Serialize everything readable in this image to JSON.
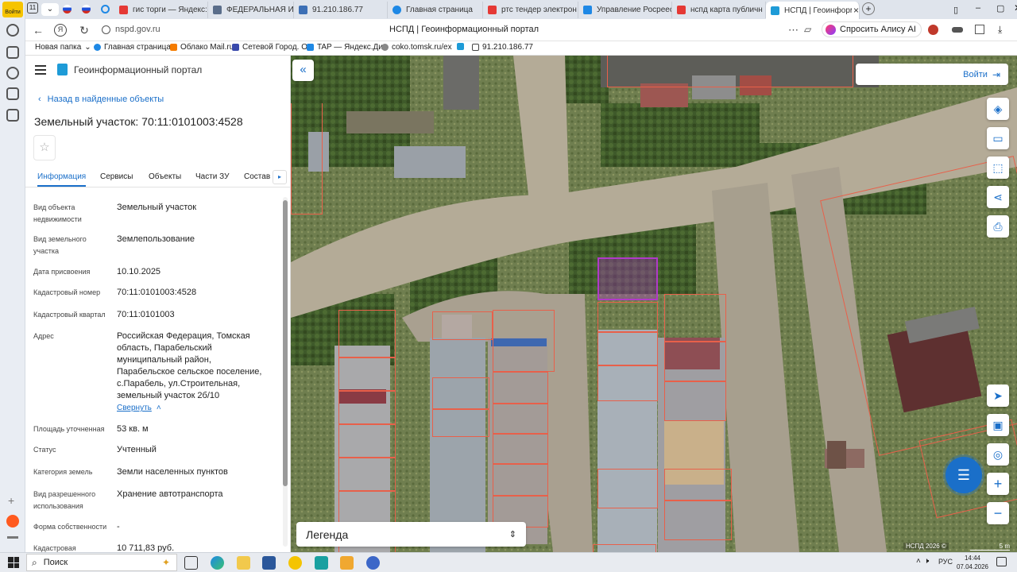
{
  "browser": {
    "sidebar_login": "Войти",
    "tab_count": "11",
    "tabs": [
      {
        "title": "гис торги — Яндекс:н",
        "color": "#e53935"
      },
      {
        "title": "ФЕДЕРАЛЬНАЯ ИНФ",
        "color": "#5a6d8a"
      },
      {
        "title": "91.210.186.77",
        "color": "#3c6fb5"
      },
      {
        "title": "Главная страница",
        "color": "#1e88e5"
      },
      {
        "title": "ртс тендер электрон",
        "color": "#e53935"
      },
      {
        "title": "Управление Росреес",
        "color": "#1e88e5"
      },
      {
        "title": "нспд карта публичн",
        "color": "#e53935"
      },
      {
        "title": "НСПД | Геоинформ",
        "color": "#1e9bd7"
      }
    ],
    "tab_close": "×",
    "new_tab": "+",
    "url": "nspd.gov.ru",
    "page_title": "НСПД | Геоинформационный портал",
    "alice_label": "Спросить Алису AI",
    "bookmarks": [
      {
        "label": "Новая папка",
        "color": ""
      },
      {
        "label": "Главная страница",
        "color": "#1e88e5"
      },
      {
        "label": "Облако Mail.ru",
        "color": "#f57c00"
      },
      {
        "label": "Сетевой Город. О",
        "color": "#3949ab"
      },
      {
        "label": "TAP — Яндекс.Ди",
        "color": "#1e88e5"
      },
      {
        "label": "coko.tomsk.ru/ex",
        "color": "#888888"
      },
      {
        "label": "",
        "color": "#1e9bd7"
      },
      {
        "label": "91.210.186.77",
        "color": "#444444"
      }
    ]
  },
  "portal": {
    "brand": "Геоинформационный портал",
    "back_link": "Назад в найденные объекты",
    "object_title": "Земельный участок: 70:11:0101003:4528",
    "tabs": [
      "Информация",
      "Сервисы",
      "Объекты",
      "Части ЗУ",
      "Состав"
    ],
    "fields": [
      {
        "label": "Вид объекта недвижимости",
        "value": "Земельный участок"
      },
      {
        "label": "Вид земельного участка",
        "value": "Землепользование"
      },
      {
        "label": "Дата присвоения",
        "value": "10.10.2025"
      },
      {
        "label": "Кадастровый номер",
        "value": "70:11:0101003:4528"
      },
      {
        "label": "Кадастровый квартал",
        "value": "70:11:0101003"
      },
      {
        "label": "Адрес",
        "value": "Российская Федерация, Томская область, Парабельский муниципальный район, Парабельское сельское поселение, с.Парабель, ул.Строительная, земельный участок 2б/10"
      },
      {
        "label": "Площадь уточненная",
        "value": "53 кв. м"
      },
      {
        "label": "Статус",
        "value": "Учтенный"
      },
      {
        "label": "Категория земель",
        "value": "Земли населенных пунктов"
      },
      {
        "label": "Вид разрешенного использования",
        "value": "Хранение автотранспорта"
      },
      {
        "label": "Форма собственности",
        "value": "-"
      },
      {
        "label": "Кадастровая",
        "value": "10 711,83 руб."
      }
    ],
    "collapse_link": "Свернуть"
  },
  "map": {
    "login_button": "Войти",
    "legend_label": "Легенда",
    "copyright": "НСПД 2026 ©",
    "scale": "5 m",
    "colors": {
      "plot_border": "#e8604a",
      "selected_plot": "#b03ac8",
      "accent": "#1a6fc9"
    }
  },
  "taskbar": {
    "search_label": "Поиск",
    "language": "РУС",
    "time": "14:44",
    "date": "07.04.2026"
  }
}
